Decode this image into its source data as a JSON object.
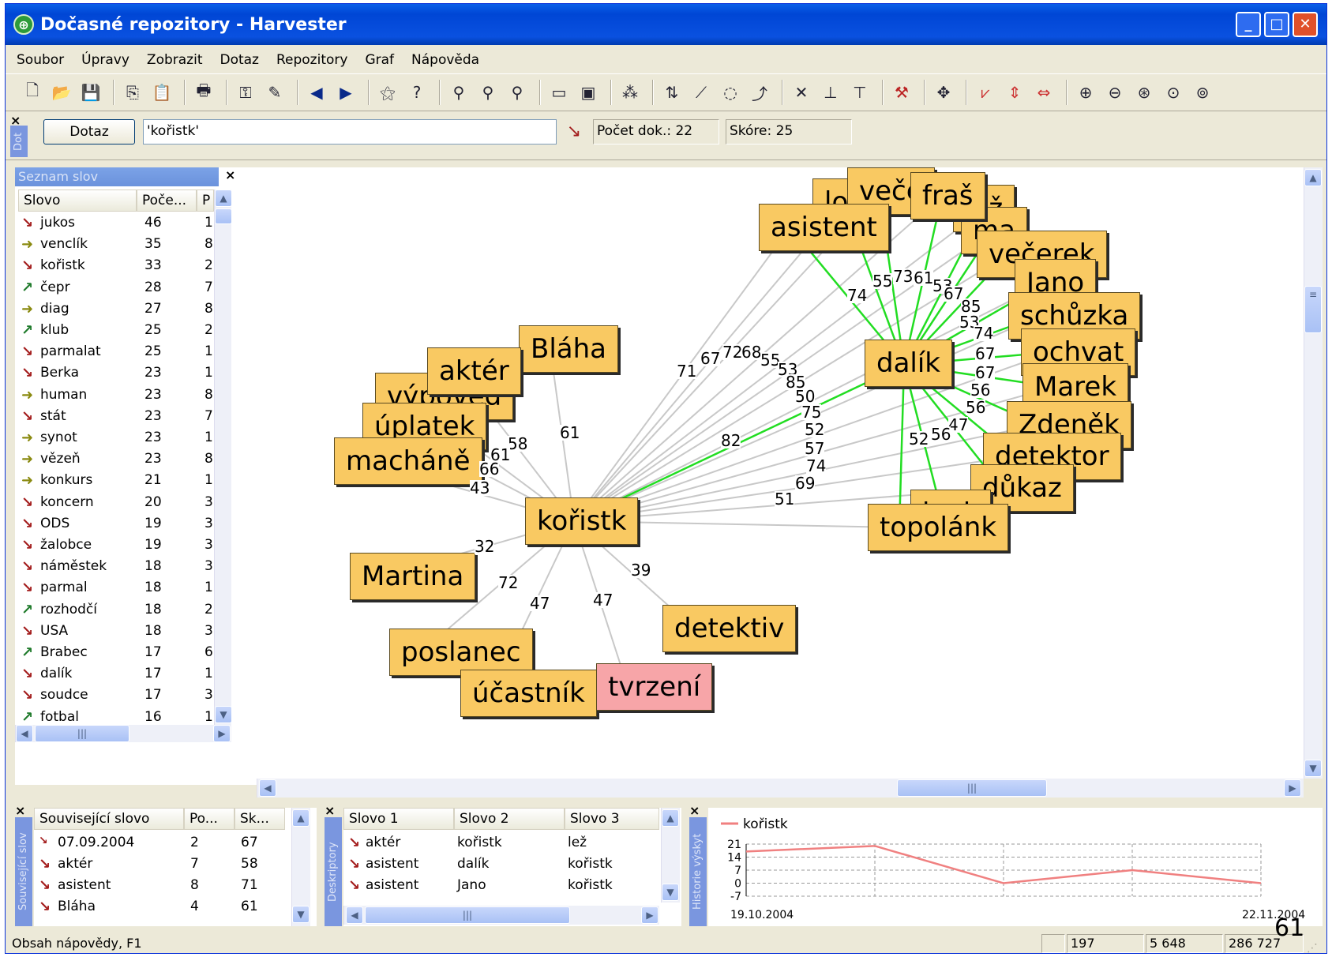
{
  "window": {
    "title": "Dočasné repozitory - Harvester"
  },
  "menu": [
    "Soubor",
    "Úpravy",
    "Zobrazit",
    "Dotaz",
    "Repozitory",
    "Graf",
    "Nápověda"
  ],
  "query": {
    "tab_label": "Dot",
    "button": "Dotaz",
    "value": "'kořistk'",
    "count": "Počet dok.: 22",
    "score": "Skóre: 25"
  },
  "wordlist": {
    "title": "Seznam slov",
    "columns": [
      "Slovo",
      "Poče...",
      "P"
    ],
    "rows": [
      {
        "word": "jukos",
        "count": "46",
        "p": "1",
        "icon": "red"
      },
      {
        "word": "venclík",
        "count": "35",
        "p": "8",
        "icon": "olive"
      },
      {
        "word": "kořistk",
        "count": "33",
        "p": "2",
        "icon": "red"
      },
      {
        "word": "čepr",
        "count": "28",
        "p": "7",
        "icon": "green"
      },
      {
        "word": "diag",
        "count": "27",
        "p": "8",
        "icon": "olive"
      },
      {
        "word": "klub",
        "count": "25",
        "p": "2",
        "icon": "green"
      },
      {
        "word": "parmalat",
        "count": "25",
        "p": "1",
        "icon": "red"
      },
      {
        "word": "Berka",
        "count": "23",
        "p": "1",
        "icon": "red"
      },
      {
        "word": "human",
        "count": "23",
        "p": "8",
        "icon": "olive"
      },
      {
        "word": "stát",
        "count": "23",
        "p": "7",
        "icon": "red"
      },
      {
        "word": "synot",
        "count": "23",
        "p": "1",
        "icon": "olive"
      },
      {
        "word": "vězeň",
        "count": "23",
        "p": "8",
        "icon": "olive"
      },
      {
        "word": "konkurs",
        "count": "21",
        "p": "1",
        "icon": "olive"
      },
      {
        "word": "koncern",
        "count": "20",
        "p": "3",
        "icon": "red"
      },
      {
        "word": "ODS",
        "count": "19",
        "p": "3",
        "icon": "red"
      },
      {
        "word": "žalobce",
        "count": "19",
        "p": "3",
        "icon": "red"
      },
      {
        "word": "náměstek",
        "count": "18",
        "p": "3",
        "icon": "red"
      },
      {
        "word": "parmal",
        "count": "18",
        "p": "1",
        "icon": "red"
      },
      {
        "word": "rozhodčí",
        "count": "18",
        "p": "2",
        "icon": "green"
      },
      {
        "word": "USA",
        "count": "18",
        "p": "3",
        "icon": "red"
      },
      {
        "word": "Brabec",
        "count": "17",
        "p": "6",
        "icon": "green"
      },
      {
        "word": "dalík",
        "count": "17",
        "p": "1",
        "icon": "red"
      },
      {
        "word": "soudce",
        "count": "17",
        "p": "3",
        "icon": "red"
      },
      {
        "word": "fotbal",
        "count": "16",
        "p": "1",
        "icon": "green"
      }
    ]
  },
  "graph": {
    "nodes": {
      "koristk": "kořistk",
      "blaha": "Bláha",
      "akter": "aktér",
      "vypoved": "výpověď",
      "uplatek": "úplatek",
      "machane": "macháně",
      "martina": "Martina",
      "poslanec": "poslanec",
      "ucastnik": "účastník",
      "tvrzeni": "tvrzení",
      "detektiv": "detektiv",
      "dalik": "dalík",
      "asistent": "asistent",
      "fras": "fraš",
      "lez": "lež",
      "lo": "lo",
      "vece": "veče",
      "ma": "ma",
      "vecerek": "večerek",
      "jano": "Jano",
      "schuzka": "schůzka",
      "ochvat": "ochvat",
      "marek": "Marek",
      "zdenek": "Zdeněk",
      "detektor": "detektor",
      "dukaz": "důkaz",
      "inek": "inek",
      "topolank": "topolánk"
    },
    "edge_labels": {
      "blaha": "61",
      "akter": "58",
      "vypoved": "61",
      "uplatek": "66",
      "machane": "43",
      "martina": "32",
      "poslanec": "72",
      "ucastnik": "47",
      "tvrzeni": "47",
      "detektiv": "39",
      "dalik": "82",
      "f1": "71",
      "f2": "67",
      "f3": "72",
      "f4": "68",
      "f5": "55",
      "f6": "53",
      "f7": "85",
      "f8": "50",
      "f9": "75",
      "f10": "52",
      "f11": "57",
      "f12": "74",
      "f13": "69",
      "f14": "51",
      "d1": "74",
      "d2": "55",
      "d3": "73",
      "d4": "61",
      "d5": "53",
      "d6": "67",
      "d7": "85",
      "d8": "53",
      "d9": "74",
      "d10": "67",
      "d11": "67",
      "d12": "56",
      "d13": "56",
      "d14": "47",
      "d15": "56",
      "d16": "52"
    }
  },
  "related": {
    "tab_label": "Související slov",
    "columns": [
      "Související slovo",
      "Po...",
      "Sk..."
    ],
    "rows": [
      {
        "word": "07.09.2004",
        "po": "2",
        "sk": "67",
        "icon": "small"
      },
      {
        "word": "aktér",
        "po": "7",
        "sk": "58",
        "icon": "red"
      },
      {
        "word": "asistent",
        "po": "8",
        "sk": "71",
        "icon": "red"
      },
      {
        "word": "Bláha",
        "po": "4",
        "sk": "61",
        "icon": "red"
      }
    ]
  },
  "descriptors": {
    "tab_label": "Deskriptory",
    "columns": [
      "Slovo 1",
      "Slovo 2",
      "Slovo 3"
    ],
    "rows": [
      [
        "aktér",
        "kořistk",
        "lež"
      ],
      [
        "asistent",
        "dalík",
        "kořistk"
      ],
      [
        "asistent",
        "Jano",
        "kořistk"
      ]
    ]
  },
  "history": {
    "tab_label": "Historie výskyt",
    "legend": "kořistk",
    "yticks": [
      "21",
      "14",
      "7",
      "0",
      "-7"
    ],
    "xstart": "19.10.2004",
    "xend": "22.11.2004",
    "series_color": "#f08080",
    "chart_data": {
      "type": "line",
      "x": [
        "19.10.2004",
        "",
        "",
        "",
        "",
        "22.11.2004"
      ],
      "series": [
        {
          "name": "kořistk",
          "values": [
            17,
            20,
            0,
            7,
            0
          ]
        }
      ],
      "ylim": [
        -7,
        21
      ]
    }
  },
  "status": {
    "help": "Obsah nápovědy, F1",
    "v1": "197",
    "v2": "5 648",
    "v3": "286 727"
  },
  "slide_number": "61"
}
